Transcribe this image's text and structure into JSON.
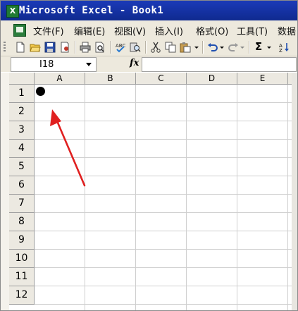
{
  "window": {
    "title": "Microsoft Excel - Book1"
  },
  "menu": {
    "items": [
      "文件(F)",
      "编辑(E)",
      "视图(V)",
      "插入(I)",
      "格式(O)",
      "工具(T)",
      "数据"
    ]
  },
  "toolbar": {
    "icons": [
      "new-icon",
      "open-icon",
      "save-icon",
      "permission-icon",
      "print-icon",
      "print-preview-icon",
      "spelling-icon",
      "research-icon",
      "cut-icon",
      "copy-icon",
      "paste-icon",
      "undo-icon",
      "redo-icon",
      "autosum-icon"
    ],
    "sum_label": "Σ"
  },
  "formula_bar": {
    "name_box": "I18",
    "fx_label": "fx",
    "formula": ""
  },
  "sheet": {
    "columns": [
      "A",
      "B",
      "C",
      "D",
      "E"
    ],
    "rows": [
      "1",
      "2",
      "3",
      "4",
      "5",
      "6",
      "7",
      "8",
      "9",
      "10",
      "11",
      "12"
    ]
  },
  "annotation": {
    "marker_cell": "A1",
    "arrow_color": "#e02020"
  }
}
